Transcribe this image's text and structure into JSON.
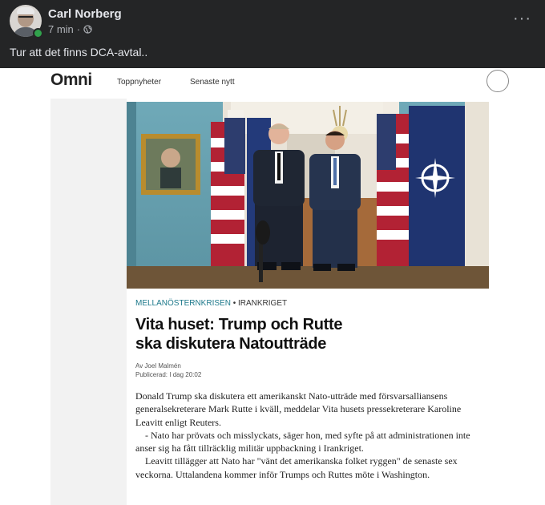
{
  "post": {
    "author": "Carl Norberg",
    "time": "7 min",
    "separator": "·",
    "more": "···",
    "text": "Tur att det finns DCA-avtal.."
  },
  "omni": {
    "logo": "Omni",
    "nav": [
      "Toppnyheter",
      "Senaste nytt"
    ]
  },
  "article": {
    "section_kicker": "MELLANÖSTERNKRISEN",
    "section_sep": " • ",
    "section_topic": "IRANKRIGET",
    "headline_line1": "Vita huset: Trump och Rutte",
    "headline_line2": "ska diskutera Natoutträde",
    "author": "Av Joel Malmén",
    "published": "Publicerad: I dag 20:02",
    "paragraphs": [
      "Donald Trump ska diskutera ett amerikanskt Nato-utträde med försvarsalliansens generalsekreterare Mark Rutte i kväll, meddelar Vita husets pressekreterare Karoline Leavitt enligt Reuters.",
      "- Nato har prövats och misslyckats, säger hon, med syfte på att administrationen inte anser sig ha fått tillräcklig militär uppbackning i Irankriget.",
      "Leavitt tillägger att Nato har \"vänt det amerikanska folket ryggen\" de senaste sex veckorna. Uttalandena kommer inför Trumps och Ruttes möte i Washington."
    ]
  },
  "colors": {
    "fb_bg": "#242526",
    "fb_text": "#e4e6eb",
    "fb_meta": "#b0b3b8",
    "online": "#31a24c",
    "kicker": "#1f7a8c"
  },
  "icons": [
    "avatar",
    "online-dot",
    "globe-icon",
    "more-options-icon",
    "search-icon"
  ]
}
